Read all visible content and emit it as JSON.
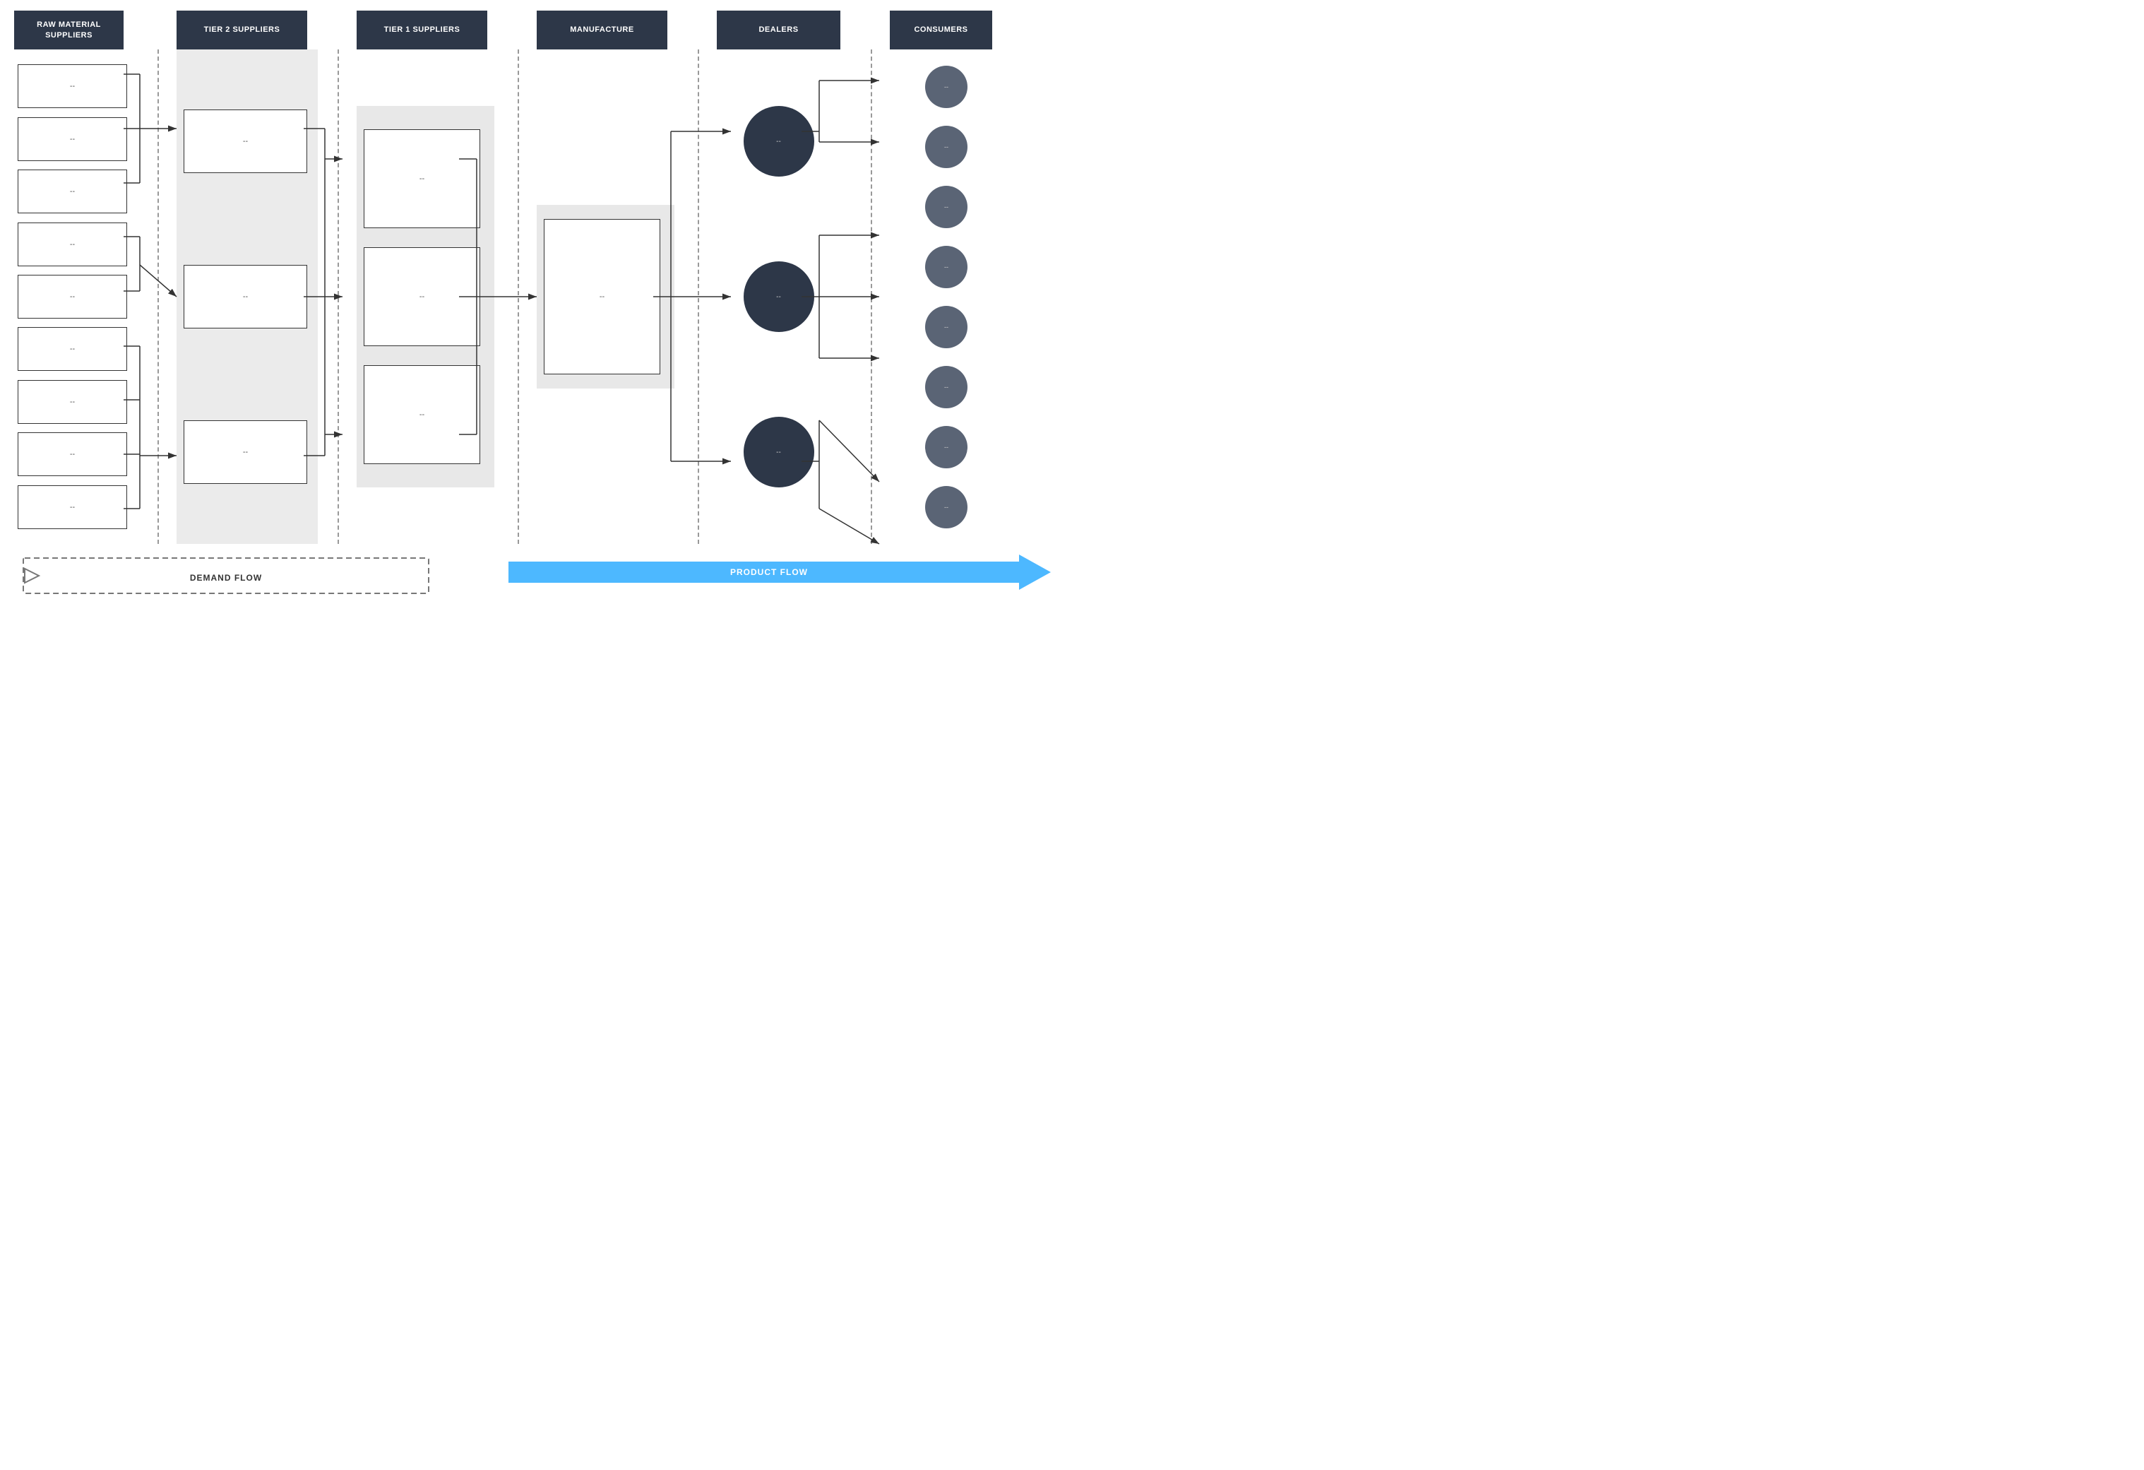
{
  "headers": {
    "raw_material": "RAW MATERIAL SUPPLIERS",
    "tier2": "TIER 2 SUPPLIERS",
    "tier1": "TIER 1 SUPPLIERS",
    "manufacture": "MANUFACTURE",
    "dealers": "DEALERS",
    "consumers": "CONSUMERS"
  },
  "raw_boxes": [
    {
      "label": "--"
    },
    {
      "label": "--"
    },
    {
      "label": "--"
    },
    {
      "label": "--"
    },
    {
      "label": "--"
    },
    {
      "label": "--"
    },
    {
      "label": "--"
    },
    {
      "label": "--"
    },
    {
      "label": "--"
    }
  ],
  "tier2_boxes": [
    {
      "label": "--"
    },
    {
      "label": "--"
    },
    {
      "label": "--"
    }
  ],
  "tier1_boxes": [
    {
      "label": "--"
    },
    {
      "label": "--"
    },
    {
      "label": "--"
    }
  ],
  "manufacture_box": {
    "label": "--"
  },
  "dealer_circles": [
    {
      "label": "--"
    },
    {
      "label": "--"
    },
    {
      "label": "--"
    }
  ],
  "consumer_circles": [
    {
      "label": "--"
    },
    {
      "label": "--"
    },
    {
      "label": "--"
    },
    {
      "label": "--"
    },
    {
      "label": "--"
    },
    {
      "label": "--"
    },
    {
      "label": "--"
    },
    {
      "label": "--"
    }
  ],
  "flow": {
    "demand_label": "DEMAND FLOW",
    "product_label": "PRODUCT FLOW"
  }
}
